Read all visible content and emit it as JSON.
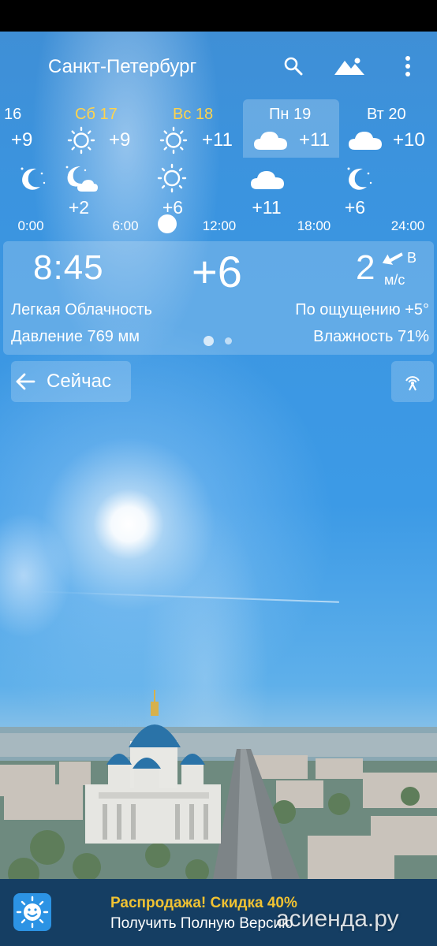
{
  "header": {
    "city": "Санкт-Петербург",
    "icons": [
      "search-icon",
      "landscape-icon",
      "more-vert-icon"
    ]
  },
  "days": [
    {
      "label": "16",
      "temp": "+9",
      "icon": "none",
      "weekend": false
    },
    {
      "label": "Сб 17",
      "temp": "+9",
      "icon": "sun-icon",
      "weekend": true
    },
    {
      "label": "Вс 18",
      "temp": "+11",
      "icon": "sun-icon",
      "weekend": true
    },
    {
      "label": "Пн 19",
      "temp": "+11",
      "icon": "cloud-icon",
      "weekend": false,
      "selected": true
    },
    {
      "label": "Вт 20",
      "temp": "+10",
      "icon": "cloud-icon",
      "weekend": false
    }
  ],
  "hourly": {
    "slots": [
      {
        "icon": "moon-stars-icon",
        "temp": ""
      },
      {
        "icon": "moon-cloud-icon",
        "temp": "+2"
      },
      {
        "icon": "sun-icon",
        "temp": "+6"
      },
      {
        "icon": "cloud-icon",
        "temp": "+11"
      },
      {
        "icon": "moon-stars-icon",
        "temp": "+6"
      }
    ],
    "times": [
      "0:00",
      "6:00",
      "12:00",
      "18:00",
      "24:00"
    ]
  },
  "current": {
    "time": "8:45",
    "temp": "+6",
    "wind_speed": "2",
    "wind_dir": "В",
    "wind_unit": "м/с",
    "condition": "Легкая Облачность",
    "feels_like": "По ощущению +5°",
    "pressure": "Давление 769 мм",
    "humidity": "Влажность 71%",
    "page_dots": 2,
    "active_dot": 0
  },
  "now_button": {
    "label": "Сейчас",
    "icon": "arrow-left-icon"
  },
  "radar_button": {
    "icon": "radar-icon"
  },
  "banner": {
    "title": "Распродажа! Скидка 40%",
    "subtitle": "Получить Полную Версию",
    "logo_icon": "smiling-sun-logo-icon",
    "title_color": "#f1c232",
    "background": "#153e63"
  },
  "watermark": "асиенда.ру"
}
